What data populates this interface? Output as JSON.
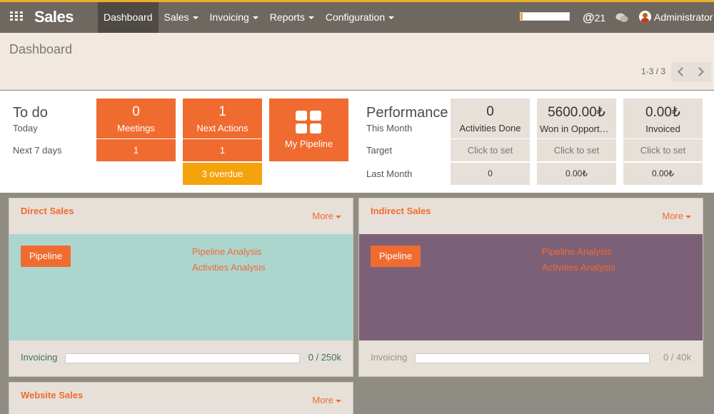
{
  "app": {
    "title": "Sales"
  },
  "nav": {
    "items": [
      {
        "label": "Dashboard",
        "active": true,
        "dropdown": false
      },
      {
        "label": "Sales",
        "active": false,
        "dropdown": true
      },
      {
        "label": "Invoicing",
        "active": false,
        "dropdown": true
      },
      {
        "label": "Reports",
        "active": false,
        "dropdown": true
      },
      {
        "label": "Configuration",
        "active": false,
        "dropdown": true
      }
    ]
  },
  "systray": {
    "progress_fraction": 0.05,
    "mentions_count": "21",
    "user_name": "Administrator"
  },
  "control_panel": {
    "breadcrumb": "Dashboard",
    "pager_value": "1-3 / 3"
  },
  "todo": {
    "title": "To do",
    "row_today": "Today",
    "row_next7": "Next 7 days",
    "meetings": {
      "count": "0",
      "label": "Meetings",
      "next7": "1"
    },
    "next_actions": {
      "count": "1",
      "label": "Next Actions",
      "next7": "1",
      "overdue": "3 overdue"
    },
    "my_pipeline": {
      "label": "My Pipeline"
    }
  },
  "performance": {
    "title": "Performance",
    "row_this_month": "This Month",
    "row_target": "Target",
    "row_last_month": "Last Month",
    "columns": [
      {
        "value": "0",
        "label": "Activities Done",
        "target": "Click to set",
        "last_month": "0"
      },
      {
        "value": "5600.00₺",
        "label": "Won in Opportunities",
        "target": "Click to set",
        "last_month": "0.00₺"
      },
      {
        "value": "0.00₺",
        "label": "Invoiced",
        "target": "Click to set",
        "last_month": "0.00₺"
      }
    ]
  },
  "teams": [
    {
      "name": "Direct Sales",
      "more": "More",
      "pipeline_button": "Pipeline",
      "link_pipeline_analysis": "Pipeline Analysis",
      "link_activities_analysis": "Activities Analysis",
      "invoicing_label": "Invoicing",
      "invoicing_value": "0 / 250k",
      "invoicing_fraction": 0,
      "color": "#acd5ce"
    },
    {
      "name": "Indirect Sales",
      "more": "More",
      "pipeline_button": "Pipeline",
      "link_pipeline_analysis": "Pipeline Analysis",
      "link_activities_analysis": "Activities Analysis",
      "invoicing_label": "Invoicing",
      "invoicing_value": "0 / 40k",
      "invoicing_fraction": 0,
      "color": "#7c6078"
    },
    {
      "name": "Website Sales",
      "more": "More"
    }
  ],
  "colors": {
    "accent": "#f06b30",
    "overdue": "#f5a30b",
    "topbar": "#6e6860",
    "topbar_accent": "#f0ad2c"
  }
}
